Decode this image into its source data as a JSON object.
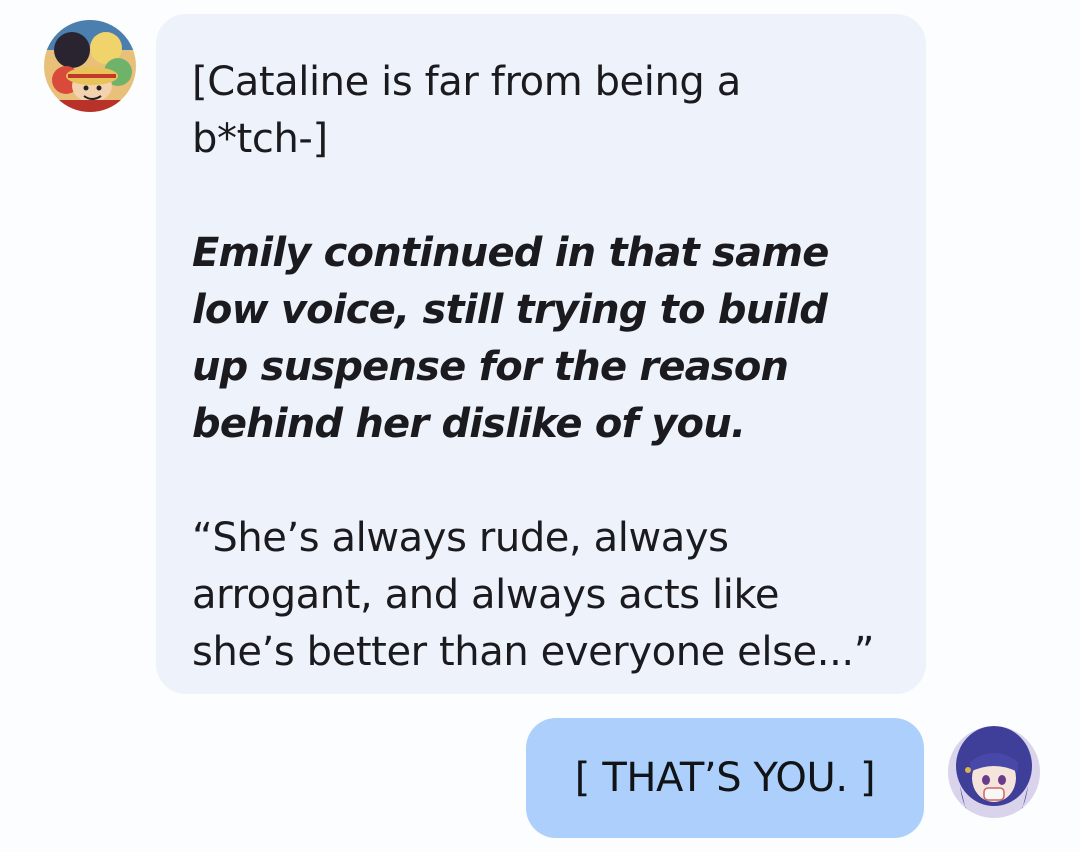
{
  "chat": {
    "bot_message": {
      "paragraphs": [
        {
          "style": "plain",
          "text": "[Cataline is far from being a b*tch-]"
        },
        {
          "style": "bold-italic",
          "text": "Emily continued in that same low voice, still trying to build up suspense for the reason behind her dislike of you."
        },
        {
          "style": "plain",
          "text": "“She’s always rude, always arrogant, and always acts like she’s better than everyone else...”"
        }
      ],
      "avatar_icon": "anime-group-avatar-icon"
    },
    "user_message": {
      "text": "[ THAT’S YOU. ]",
      "avatar_icon": "anime-girl-avatar-icon"
    }
  },
  "colors": {
    "background": "#fcfdff",
    "bot_bubble": "#eef3fb",
    "user_bubble": "#acd0fb",
    "text": "#1b1b1f"
  }
}
